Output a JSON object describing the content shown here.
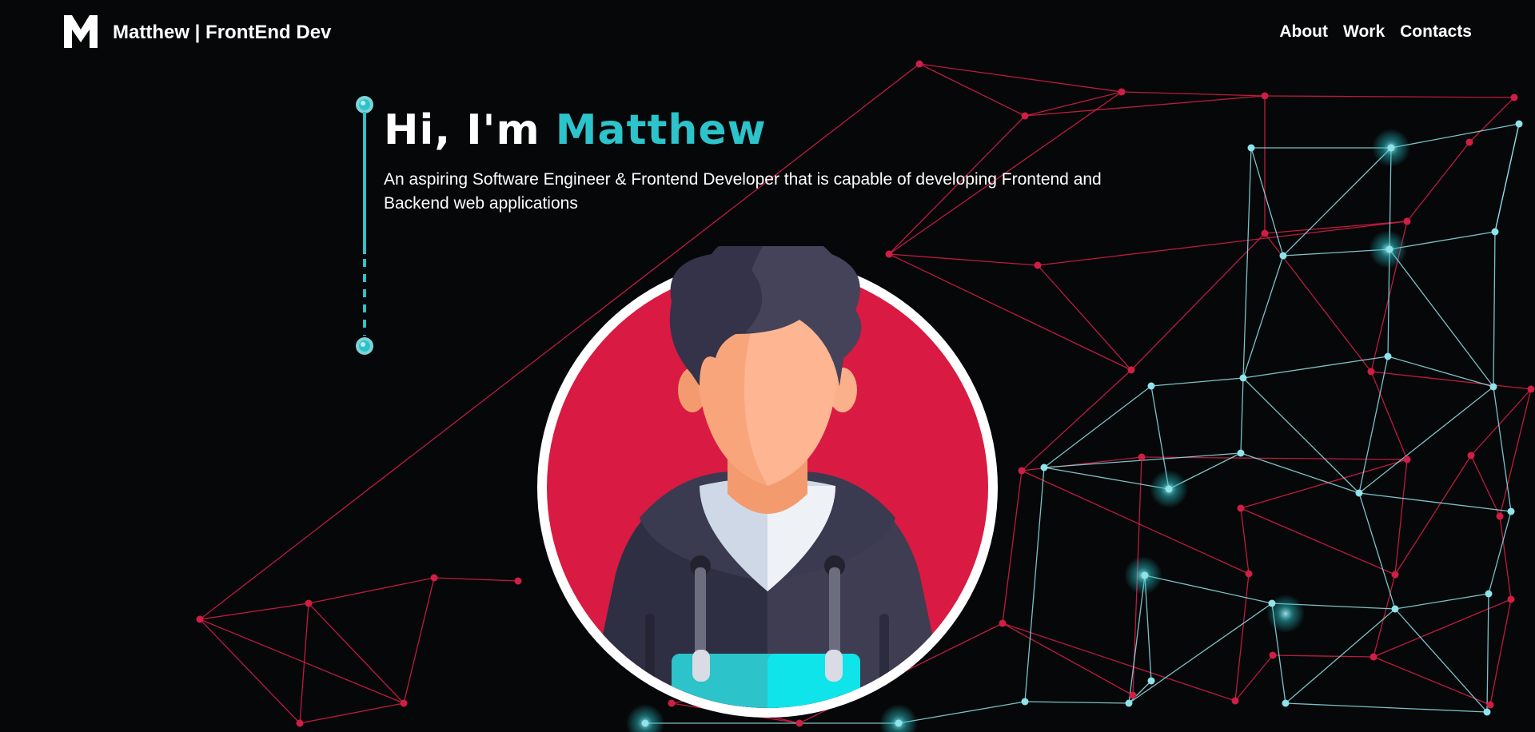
{
  "navbar": {
    "logo_icon": "m-logo-icon",
    "brand_label": "Matthew | FrontEnd Dev",
    "links": [
      {
        "label": "About"
      },
      {
        "label": "Work"
      },
      {
        "label": "Contacts"
      }
    ]
  },
  "hero": {
    "greeting": "Hi, I'm ",
    "name": "Matthew",
    "description": "An aspiring Software Engineer & Frontend Developer that is capable of developing Frontend and Backend web applications"
  },
  "avatar": {
    "icon": "developer-avatar-icon"
  },
  "colors": {
    "background": "#060708",
    "accent": "#2cc3cb",
    "network_red": "#d01e45",
    "network_cyan": "#8fe3ea",
    "avatar_bg": "#d91a42"
  }
}
